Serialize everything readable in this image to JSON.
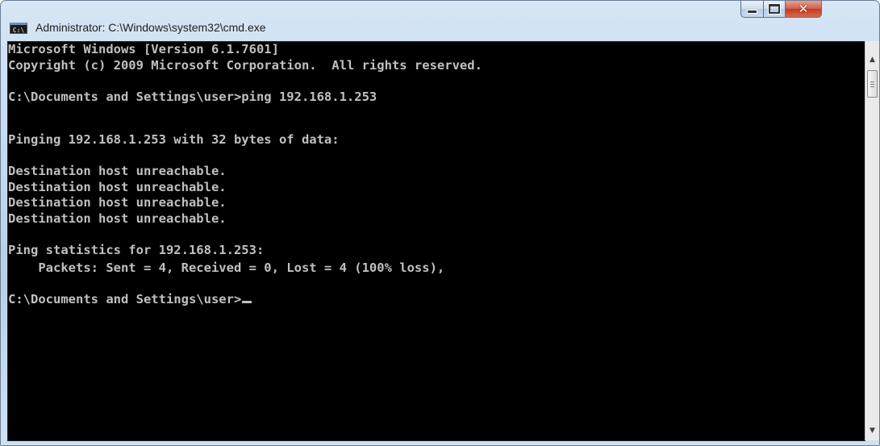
{
  "window": {
    "title": "Administrator: C:\\Windows\\system32\\cmd.exe",
    "icon_text": "C:\\",
    "icon": "cmd-icon",
    "controls": {
      "minimize_icon": "minimize-icon",
      "maximize_icon": "maximize-icon",
      "close_icon": "close-icon",
      "close_glyph": "✕"
    }
  },
  "console": {
    "lines": [
      "Microsoft Windows [Version 6.1.7601]",
      "Copyright (c) 2009 Microsoft Corporation.  All rights reserved.",
      "C:\\Documents and Settings\\user>ping 192.168.1.253",
      "Pinging 192.168.1.253 with 32 bytes of data:",
      "Destination host unreachable.",
      "Destination host unreachable.",
      "Destination host unreachable.",
      "Destination host unreachable.",
      "Ping statistics for 192.168.1.253:",
      "    Packets: Sent = 4, Received = 0, Lost = 4 (100% loss),",
      "C:\\Documents and Settings\\user>"
    ],
    "background_color": "#000000",
    "text_color": "#c0c0c0"
  },
  "scrollbar": {
    "up_arrow": "▲",
    "down_arrow": "▼"
  }
}
